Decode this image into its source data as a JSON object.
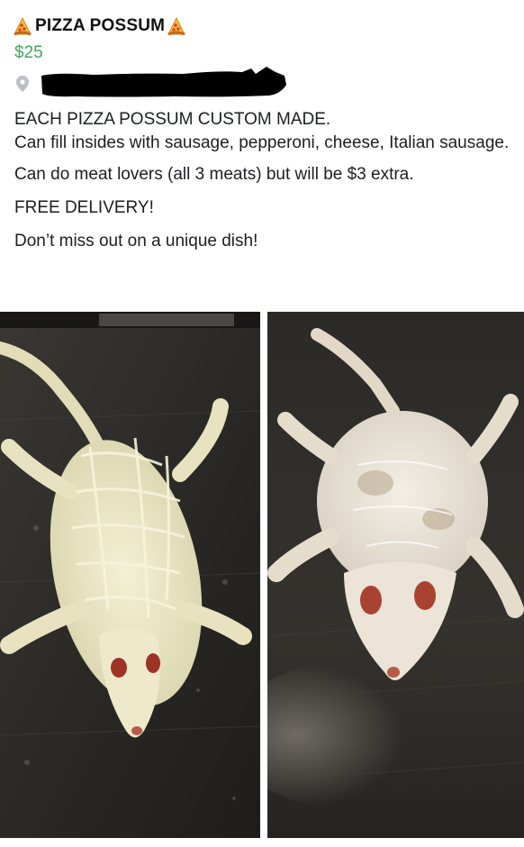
{
  "listing": {
    "title": "PIZZA POSSUM",
    "title_icons": [
      "pizza-slice-icon",
      "pizza-slice-icon"
    ],
    "price": "$25",
    "location_icon": "location-pin-icon",
    "location_redacted": true
  },
  "description": {
    "line1": "EACH PIZZA POSSUM CUSTOM MADE.",
    "line2": "Can fill insides with sausage, pepperoni, cheese, Italian sausage.",
    "line3": "Can do meat lovers (all 3 meats) but will be $3 extra.",
    "line4": "FREE DELIVERY!",
    "line5": "Don’t miss out on a unique dish!"
  },
  "photos": [
    {
      "subject": "cheese-covered-possum-photo"
    },
    {
      "subject": "glazed-possum-photo"
    }
  ],
  "colors": {
    "price_green": "#42a85f",
    "text": "#1c1e21",
    "redaction": "#000000"
  }
}
